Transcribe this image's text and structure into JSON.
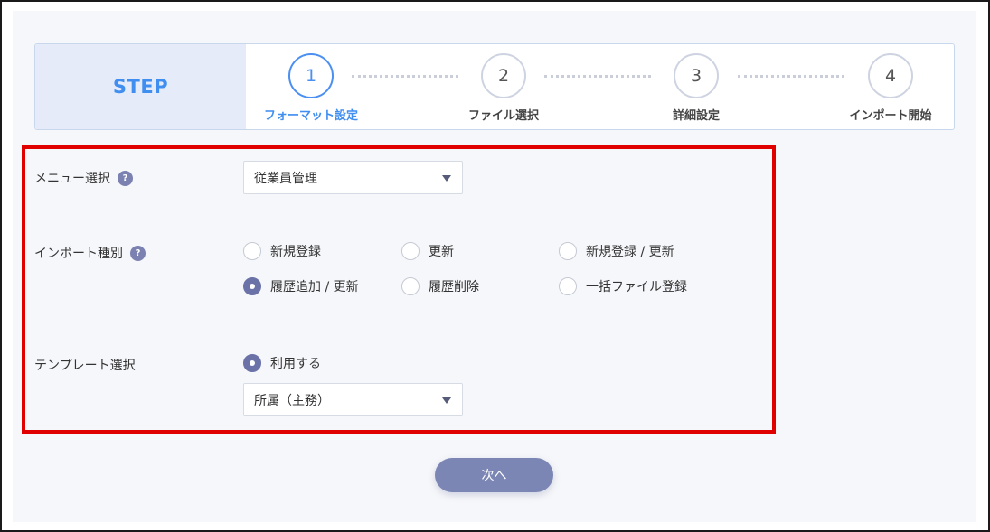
{
  "stepper": {
    "head": "STEP",
    "steps": [
      {
        "number": "1",
        "label": "フォーマット設定",
        "active": true
      },
      {
        "number": "2",
        "label": "ファイル選択",
        "active": false
      },
      {
        "number": "3",
        "label": "詳細設定",
        "active": false
      },
      {
        "number": "4",
        "label": "インポート開始",
        "active": false
      }
    ]
  },
  "form": {
    "menu": {
      "label": "メニュー選択",
      "help": "?",
      "selected": "従業員管理"
    },
    "import_type": {
      "label": "インポート種別",
      "help": "?",
      "options": [
        {
          "label": "新規登録",
          "checked": false
        },
        {
          "label": "更新",
          "checked": false
        },
        {
          "label": "新規登録 / 更新",
          "checked": false
        },
        {
          "label": "履歴追加 / 更新",
          "checked": true
        },
        {
          "label": "履歴削除",
          "checked": false
        },
        {
          "label": "一括ファイル登録",
          "checked": false
        }
      ]
    },
    "template": {
      "label": "テンプレート選択",
      "option": {
        "label": "利用する",
        "checked": true
      },
      "selected": "所属（主務）"
    }
  },
  "actions": {
    "next_label": "次へ"
  },
  "colors": {
    "accent": "#3f8ef0",
    "radio_checked": "#6a72a8",
    "button": "#7c86b5",
    "highlight": "#e00000"
  }
}
